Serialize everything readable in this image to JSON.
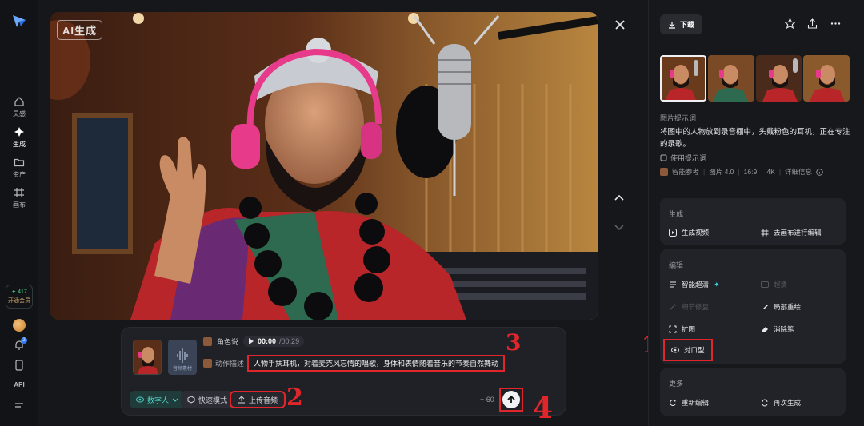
{
  "rail": {
    "items": [
      {
        "label": "灵感",
        "icon": "home-icon"
      },
      {
        "label": "生成",
        "icon": "sparkle-icon"
      },
      {
        "label": "资产",
        "icon": "folder-icon"
      },
      {
        "label": "画布",
        "icon": "canvas-icon"
      }
    ],
    "vip_count": "417",
    "vip_label": "开通会员",
    "notification_count": "2",
    "api_label": "API"
  },
  "stage": {
    "badge": "AI生成",
    "composer": {
      "role_label": "角色说",
      "time_current": "00:00",
      "time_total": "/00:29",
      "action_label": "动作描述",
      "prompt": "人物手扶耳机，对着麦克风忘情的唱歌，身体和表情随着音乐的节奏自然舞动",
      "audio_card_label": "音频素材",
      "digital_label": "数字人",
      "fast_label": "快速模式",
      "upload_label": "上传音频",
      "credits": "+ 60"
    },
    "annotations": [
      "1",
      "2",
      "3",
      "4"
    ]
  },
  "panel": {
    "download_label": "下载",
    "prompt_section": "图片提示词",
    "prompt_text": "将图中的人物放到录音棚中，头戴粉色的耳机，正在专注的录歌。",
    "use_prompt": "使用提示词",
    "meta": {
      "ref": "智能参考",
      "model": "图片 4.0",
      "ratio": "16:9",
      "res": "4K",
      "detail": "详细信息"
    },
    "generate": {
      "title": "生成",
      "items": [
        "生成视频",
        "去画布进行编辑"
      ]
    },
    "edit": {
      "title": "编辑",
      "items": [
        "智能超清",
        "超清",
        "细节修复",
        "局部重绘",
        "扩图",
        "消除笔",
        "对口型"
      ]
    },
    "more": {
      "title": "更多",
      "items": [
        "重新编辑",
        "再次生成"
      ]
    }
  }
}
